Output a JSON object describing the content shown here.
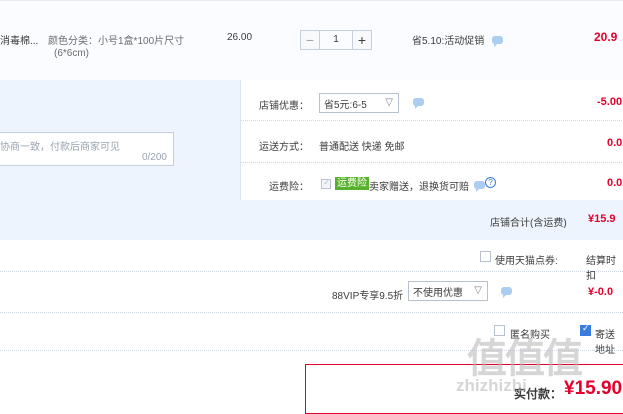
{
  "product": {
    "name_fragment": "消毒棉...",
    "spec_label": "颜色分类：小号1盒*100片尺寸",
    "spec_size": "(6*6cm)",
    "unit_price": "26.00",
    "quantity": "1",
    "minus": "−",
    "plus": "+",
    "promo_text": "省5.10:活动促销",
    "subtotal": "20.9"
  },
  "shop": {
    "discount_label": "店铺优惠：",
    "discount_select": "省5元:6-5",
    "discount_amount": "-5.00",
    "message_placeholder": "协商一致，付款后商家可见",
    "message_counter": "0/200",
    "shipping_label": "运送方式：",
    "shipping_value": "普通配送 快递 免邮",
    "shipping_amount": "0.0",
    "insurance_label": "运费险：",
    "insurance_badge": "运费险",
    "insurance_text": "卖家赠送，退换货可赔",
    "insurance_amount": "0.0",
    "subtotal_label": "店铺合计(含运费)",
    "subtotal_amount": "¥15.9"
  },
  "order": {
    "tmall_points_label": "使用天猫点券:",
    "settle_label": "结算时扣",
    "vip_label": "88VIP专享9.5折",
    "vip_select": "不使用优惠",
    "vip_amount": "¥-0.0",
    "anon_label": "匿名购买",
    "address_label": "寄送地址",
    "total_label": "实付款：",
    "total_amount": "¥15.90"
  },
  "watermark": {
    "logo_text": "值值值",
    "site_text": "zhizhizhi"
  },
  "colors": {
    "accent_red": "#e4002b",
    "band_blue": "#eef4fd",
    "link_blue": "#3a7be0",
    "badge_green": "#58b12c"
  },
  "icons": [
    "chat-icon",
    "question-icon",
    "chevron-down-icon",
    "checkbox-icon"
  ]
}
